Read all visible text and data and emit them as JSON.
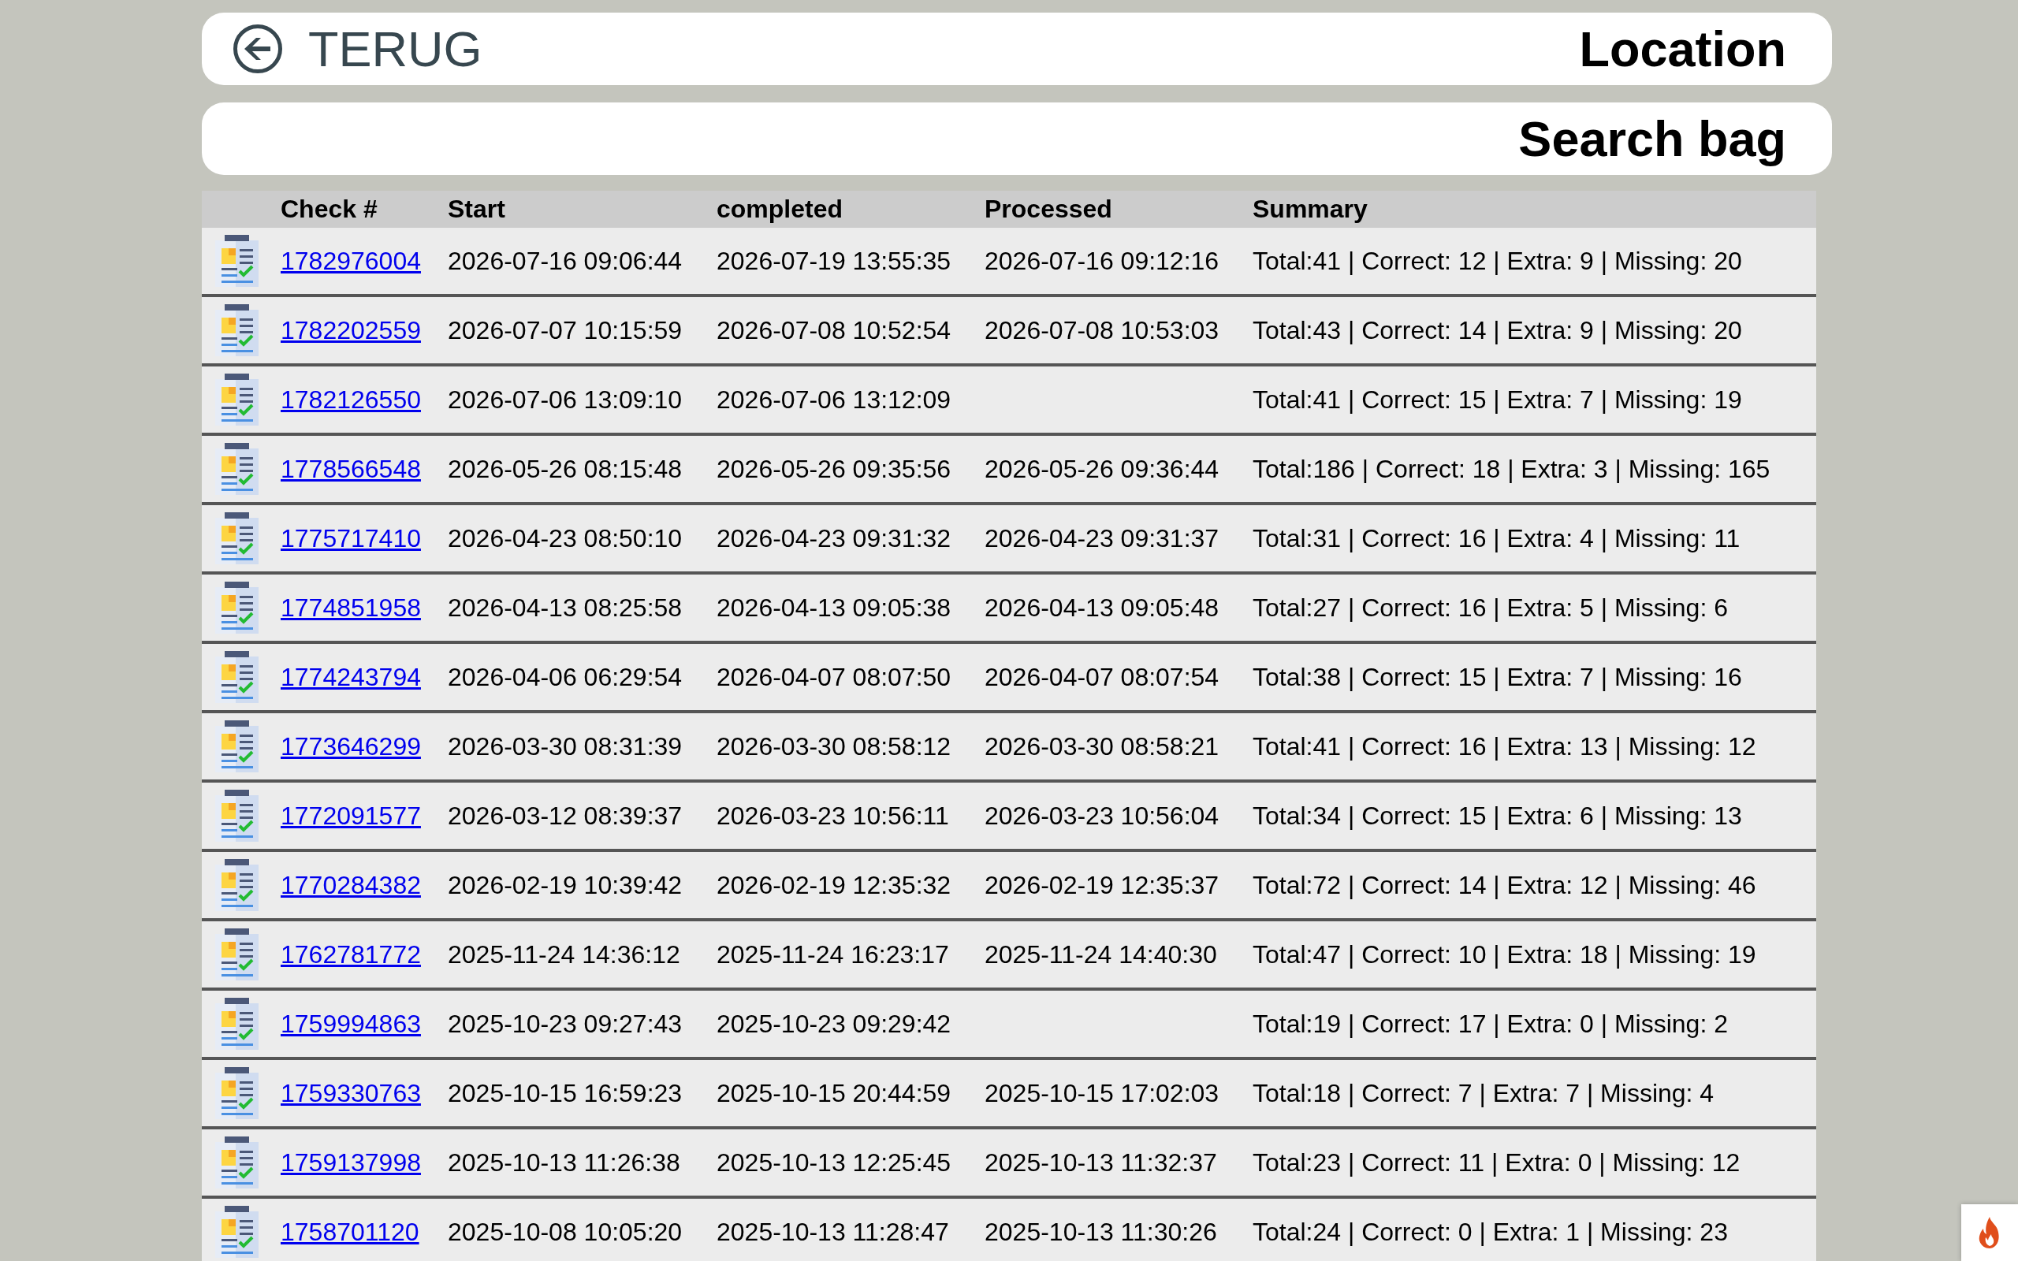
{
  "header": {
    "back_label": "TERUG",
    "title": "Location"
  },
  "subheader": {
    "title": "Search bag"
  },
  "table": {
    "columns": [
      "Check #",
      "Start",
      "completed",
      "Processed",
      "Summary"
    ],
    "rows": [
      {
        "check": "1782976004",
        "start": "2026-07-16 09:06:44",
        "completed": "2026-07-19 13:55:35",
        "processed": "2026-07-16 09:12:16",
        "summary": "Total:41 | Correct: 12 | Extra: 9 | Missing: 20"
      },
      {
        "check": "1782202559",
        "start": "2026-07-07 10:15:59",
        "completed": "2026-07-08 10:52:54",
        "processed": "2026-07-08 10:53:03",
        "summary": "Total:43 | Correct: 14 | Extra: 9 | Missing: 20"
      },
      {
        "check": "1782126550",
        "start": "2026-07-06 13:09:10",
        "completed": "2026-07-06 13:12:09",
        "summary": "Total:41 | Correct: 15 | Extra: 7 | Missing: 19"
      },
      {
        "check": "1778566548",
        "start": "2026-05-26 08:15:48",
        "completed": "2026-05-26 09:35:56",
        "processed": "2026-05-26 09:36:44",
        "summary": "Total:186 | Correct: 18 | Extra: 3 | Missing: 165"
      },
      {
        "check": "1775717410",
        "start": "2026-04-23 08:50:10",
        "completed": "2026-04-23 09:31:32",
        "processed": "2026-04-23 09:31:37",
        "summary": "Total:31 | Correct: 16 | Extra: 4 | Missing: 11"
      },
      {
        "check": "1774851958",
        "start": "2026-04-13 08:25:58",
        "completed": "2026-04-13 09:05:38",
        "processed": "2026-04-13 09:05:48",
        "summary": "Total:27 | Correct: 16 | Extra: 5 | Missing: 6"
      },
      {
        "check": "1774243794",
        "start": "2026-04-06 06:29:54",
        "completed": "2026-04-07 08:07:50",
        "processed": "2026-04-07 08:07:54",
        "summary": "Total:38 | Correct: 15 | Extra: 7 | Missing: 16"
      },
      {
        "check": "1773646299",
        "start": "2026-03-30 08:31:39",
        "completed": "2026-03-30 08:58:12",
        "processed": "2026-03-30 08:58:21",
        "summary": "Total:41 | Correct: 16 | Extra: 13 | Missing: 12"
      },
      {
        "check": "1772091577",
        "start": "2026-03-12 08:39:37",
        "completed": "2026-03-23 10:56:11",
        "processed": "2026-03-23 10:56:04",
        "summary": "Total:34 | Correct: 15 | Extra: 6 | Missing: 13"
      },
      {
        "check": "1770284382",
        "start": "2026-02-19 10:39:42",
        "completed": "2026-02-19 12:35:32",
        "processed": "2026-02-19 12:35:37",
        "summary": "Total:72 | Correct: 14 | Extra: 12 | Missing: 46"
      },
      {
        "check": "1762781772",
        "start": "2025-11-24 14:36:12",
        "completed": "2025-11-24 16:23:17",
        "processed": "2025-11-24 14:40:30",
        "summary": "Total:47 | Correct: 10 | Extra: 18 | Missing: 19"
      },
      {
        "check": "1759994863",
        "start": "2025-10-23 09:27:43",
        "completed": "2025-10-23 09:29:42",
        "summary": "Total:19 | Correct: 17 | Extra: 0 | Missing: 2"
      },
      {
        "check": "1759330763",
        "start": "2025-10-15 16:59:23",
        "completed": "2025-10-15 20:44:59",
        "processed": "2025-10-15 17:02:03",
        "summary": "Total:18 | Correct: 7 | Extra: 7 | Missing: 4"
      },
      {
        "check": "1759137998",
        "start": "2025-10-13 11:26:38",
        "completed": "2025-10-13 12:25:45",
        "processed": "2025-10-13 11:32:37",
        "summary": "Total:23 | Correct: 11 | Extra: 0 | Missing: 12"
      },
      {
        "check": "1758701120",
        "start": "2025-10-08 10:05:20",
        "completed": "2025-10-13 11:28:47",
        "processed": "2025-10-13 11:30:26",
        "summary": "Total:24 | Correct: 0 | Extra: 1 | Missing: 23"
      }
    ]
  }
}
